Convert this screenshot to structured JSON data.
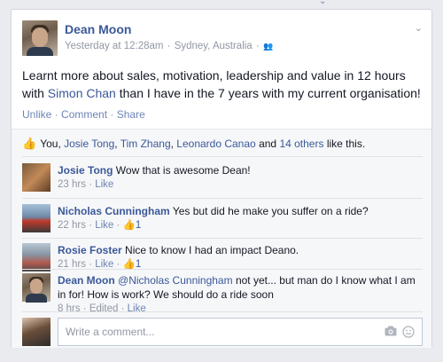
{
  "post": {
    "author": "Dean Moon",
    "time": "Yesterday at 12:28am",
    "location": "Sydney, Australia",
    "audience_icon": "friends-icon",
    "text_before": "Learnt more about sales, motivation, leadership and value in 12 hours with ",
    "mention": "Simon Chan",
    "text_after": " than I have in the 7 years with my current organisation!",
    "actions": {
      "unlike": "Unlike",
      "comment": "Comment",
      "share": "Share"
    }
  },
  "likes": {
    "you": "You",
    "names": [
      "Josie Tong",
      "Tim Zhang",
      "Leonardo Canao"
    ],
    "and": "and",
    "others": "14 others",
    "suffix": "like this."
  },
  "comments": [
    {
      "name": "Josie Tong",
      "text": "Wow that is awesome Dean!",
      "time": "23 hrs",
      "like": "Like",
      "likes": ""
    },
    {
      "name": "Nicholas Cunningham",
      "text": "Yes but did he make you suffer on a ride?",
      "time": "22 hrs",
      "like": "Like",
      "likes": "1"
    },
    {
      "name": "Rosie Foster",
      "text": "Nice to know I had an impact Deano.",
      "time": "21 hrs",
      "like": "Like",
      "likes": "1"
    },
    {
      "name": "Dean Moon",
      "mention": "@Nicholas Cunningham",
      "text": " not yet... but man do I know what I am in for! How is work? We should do a ride soon",
      "time": "8 hrs",
      "edited": "Edited",
      "like": "Like"
    }
  ],
  "composer": {
    "placeholder": "Write a comment..."
  }
}
